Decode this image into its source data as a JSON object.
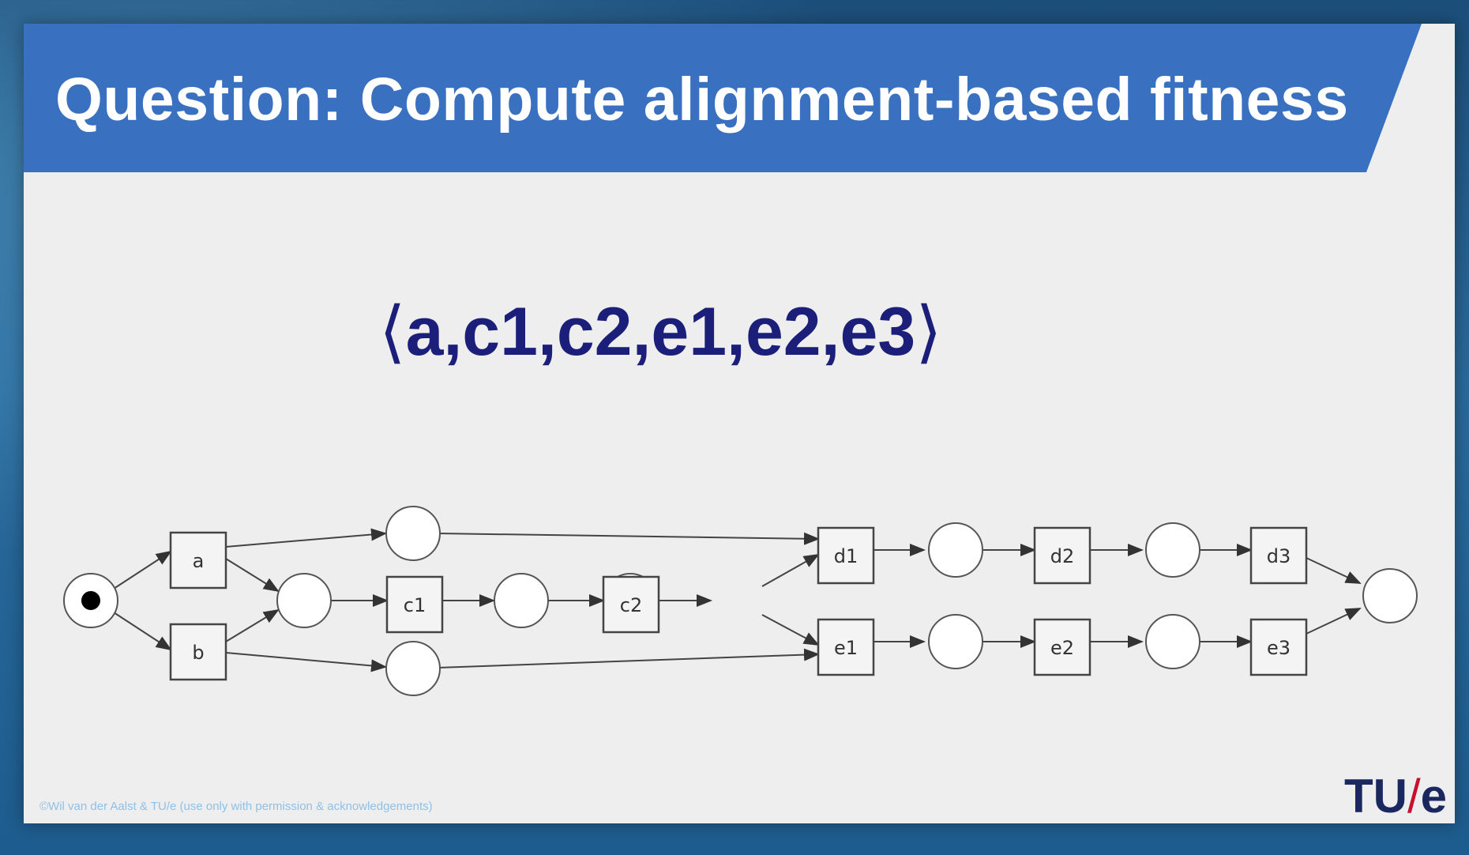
{
  "slide": {
    "title": "Question: Compute alignment-based fitness",
    "trace": {
      "open": "⟨",
      "close": "⟩",
      "events_text": "a,c1,c2,e1,e2,e3"
    },
    "footer_note": "©Wil van der Aalst & TU/e (use only with permission & acknowledgements)",
    "logo": {
      "left": "TU",
      "slash": "/",
      "right": "e"
    }
  },
  "petri_net": {
    "transitions": [
      "a",
      "b",
      "c1",
      "c2",
      "d1",
      "d2",
      "d3",
      "e1",
      "e2",
      "e3"
    ],
    "initial_marking": [
      "start"
    ]
  },
  "colors": {
    "title_bar": "#3a70c0",
    "trace_text": "#1b1f7a",
    "logo_text": "#1b2860",
    "logo_slash": "#c8102e"
  }
}
